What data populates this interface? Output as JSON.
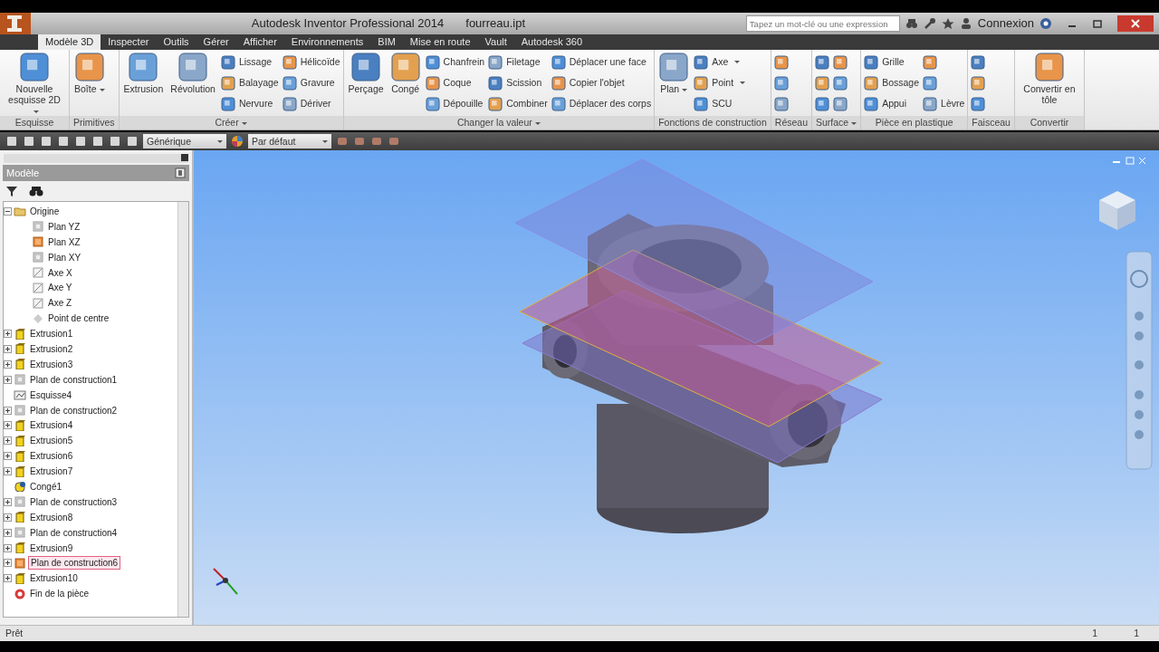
{
  "window": {
    "title": "Autodesk Inventor Professional 2014",
    "file": "fourreau.ipt"
  },
  "search": {
    "placeholder": "Tapez un mot-clé ou une expression"
  },
  "account": {
    "label": "Connexion"
  },
  "ribbon_tabs": [
    {
      "label": "Modèle 3D",
      "selected": true
    },
    {
      "label": "Inspecter",
      "selected": false
    },
    {
      "label": "Outils",
      "selected": false
    },
    {
      "label": "Gérer",
      "selected": false
    },
    {
      "label": "Afficher",
      "selected": false
    },
    {
      "label": "Environnements",
      "selected": false
    },
    {
      "label": "BIM",
      "selected": false
    },
    {
      "label": "Mise en route",
      "selected": false
    },
    {
      "label": "Vault",
      "selected": false
    },
    {
      "label": "Autodesk 360",
      "selected": false
    }
  ],
  "ribbon_groups": [
    {
      "label": "Esquisse",
      "dropdown": false,
      "items": [
        {
          "kind": "large",
          "label": "Nouvelle esquisse 2D",
          "dropdown": true
        }
      ]
    },
    {
      "label": "Primitives",
      "dropdown": false,
      "items": [
        {
          "kind": "large",
          "label": "Boîte",
          "dropdown": true
        }
      ]
    },
    {
      "label": "Créer",
      "dropdown": true,
      "items": [
        {
          "kind": "large",
          "label": "Extrusion",
          "dropdown": false
        },
        {
          "kind": "large",
          "label": "Révolution",
          "dropdown": false
        },
        {
          "kind": "stack",
          "tools": [
            {
              "kind": "tool",
              "label": "Lissage",
              "dropdown": false
            },
            {
              "kind": "tool",
              "label": "Balayage",
              "dropdown": false
            },
            {
              "kind": "tool",
              "label": "Nervure",
              "dropdown": false
            }
          ]
        },
        {
          "kind": "stack",
          "tools": [
            {
              "kind": "tool",
              "label": "Hélicoïde",
              "dropdown": false
            },
            {
              "kind": "tool",
              "label": "Gravure",
              "dropdown": false
            },
            {
              "kind": "tool",
              "label": "Dériver",
              "dropdown": false
            }
          ]
        }
      ]
    },
    {
      "label": "Changer la valeur",
      "dropdown": true,
      "items": [
        {
          "kind": "large",
          "label": "Perçage",
          "dropdown": false
        },
        {
          "kind": "large",
          "label": "Congé",
          "dropdown": false
        },
        {
          "kind": "stack",
          "tools": [
            {
              "kind": "tool",
              "label": "Chanfrein",
              "dropdown": false
            },
            {
              "kind": "tool",
              "label": "Coque",
              "dropdown": false
            },
            {
              "kind": "tool",
              "label": "Dépouille",
              "dropdown": false
            }
          ]
        },
        {
          "kind": "stack",
          "tools": [
            {
              "kind": "tool",
              "label": "Filetage",
              "dropdown": false
            },
            {
              "kind": "tool",
              "label": "Scission",
              "dropdown": false
            },
            {
              "kind": "tool",
              "label": "Combiner",
              "dropdown": false
            }
          ]
        },
        {
          "kind": "stack",
          "tools": [
            {
              "kind": "tool",
              "label": "Déplacer une face",
              "dropdown": false
            },
            {
              "kind": "tool",
              "label": "Copier l'objet",
              "dropdown": false
            },
            {
              "kind": "tool",
              "label": "Déplacer des corps",
              "dropdown": false
            }
          ]
        }
      ]
    },
    {
      "label": "Fonctions de construction",
      "dropdown": false,
      "items": [
        {
          "kind": "large",
          "label": "Plan",
          "dropdown": true
        },
        {
          "kind": "stack",
          "tools": [
            {
              "kind": "tool",
              "label": "Axe",
              "dropdown": true
            },
            {
              "kind": "tool",
              "label": "Point",
              "dropdown": true
            },
            {
              "kind": "tool",
              "label": "SCU",
              "dropdown": false
            }
          ]
        }
      ]
    },
    {
      "label": "Réseau",
      "dropdown": false,
      "items": [
        {
          "kind": "stack",
          "tools": [
            {
              "kind": "icon"
            },
            {
              "kind": "icon"
            },
            {
              "kind": "icon"
            }
          ]
        }
      ]
    },
    {
      "label": "Surface",
      "dropdown": true,
      "items": [
        {
          "kind": "stack",
          "tools": [
            {
              "kind": "icon"
            },
            {
              "kind": "icon"
            },
            {
              "kind": "icon"
            }
          ]
        },
        {
          "kind": "stack",
          "tools": [
            {
              "kind": "icon"
            },
            {
              "kind": "icon"
            },
            {
              "kind": "icon"
            }
          ]
        }
      ]
    },
    {
      "label": "Pièce en plastique",
      "dropdown": false,
      "items": [
        {
          "kind": "stack",
          "tools": [
            {
              "kind": "tool",
              "label": "Grille",
              "dropdown": false
            },
            {
              "kind": "tool",
              "label": "Bossage",
              "dropdown": false
            },
            {
              "kind": "tool",
              "label": "Appui",
              "dropdown": false
            }
          ]
        },
        {
          "kind": "stack",
          "tools": [
            {
              "kind": "icon"
            },
            {
              "kind": "icon"
            },
            {
              "kind": "tool",
              "label": "Lèvre",
              "dropdown": false
            }
          ]
        }
      ]
    },
    {
      "label": "Faisceau",
      "dropdown": false,
      "items": [
        {
          "kind": "stack",
          "tools": [
            {
              "kind": "icon"
            },
            {
              "kind": "icon"
            },
            {
              "kind": "icon"
            }
          ]
        }
      ]
    },
    {
      "label": "Convertir",
      "dropdown": false,
      "items": [
        {
          "kind": "large",
          "label": "Convertir en tôle",
          "dropdown": false
        }
      ]
    }
  ],
  "quick_toolbar": {
    "material": "Générique",
    "appearance": "Par défaut"
  },
  "browser": {
    "title": "Modèle",
    "tree": [
      {
        "label": "Origine",
        "kind": "folder",
        "expanded": true,
        "selected": false,
        "children": [
          {
            "label": "Plan YZ",
            "kind": "plane",
            "selected": false
          },
          {
            "label": "Plan XZ",
            "kind": "plane-visible",
            "selected": false
          },
          {
            "label": "Plan XY",
            "kind": "plane",
            "selected": false
          },
          {
            "label": "Axe X",
            "kind": "axis",
            "selected": false
          },
          {
            "label": "Axe Y",
            "kind": "axis",
            "selected": false
          },
          {
            "label": "Axe Z",
            "kind": "axis",
            "selected": false
          },
          {
            "label": "Point de centre",
            "kind": "point",
            "selected": false
          }
        ]
      },
      {
        "label": "Extrusion1",
        "kind": "extrusion",
        "expanded": false,
        "selected": false
      },
      {
        "label": "Extrusion2",
        "kind": "extrusion",
        "expanded": false,
        "selected": false
      },
      {
        "label": "Extrusion3",
        "kind": "extrusion",
        "expanded": false,
        "selected": false
      },
      {
        "label": "Plan de construction1",
        "kind": "plane",
        "expanded": false,
        "selected": false
      },
      {
        "label": "Esquisse4",
        "kind": "sketch",
        "selected": false
      },
      {
        "label": "Plan de construction2",
        "kind": "plane",
        "expanded": false,
        "selected": false
      },
      {
        "label": "Extrusion4",
        "kind": "extrusion",
        "expanded": false,
        "selected": false
      },
      {
        "label": "Extrusion5",
        "kind": "extrusion",
        "expanded": false,
        "selected": false
      },
      {
        "label": "Extrusion6",
        "kind": "extrusion",
        "expanded": false,
        "selected": false
      },
      {
        "label": "Extrusion7",
        "kind": "extrusion",
        "expanded": false,
        "selected": false
      },
      {
        "label": "Congé1",
        "kind": "fillet",
        "selected": false
      },
      {
        "label": "Plan de construction3",
        "kind": "plane",
        "expanded": false,
        "selected": false
      },
      {
        "label": "Extrusion8",
        "kind": "extrusion",
        "expanded": false,
        "selected": false
      },
      {
        "label": "Plan de construction4",
        "kind": "plane",
        "expanded": false,
        "selected": false
      },
      {
        "label": "Extrusion9",
        "kind": "extrusion",
        "expanded": false,
        "selected": false
      },
      {
        "label": "Plan de construction6",
        "kind": "plane-visible",
        "expanded": false,
        "selected": true
      },
      {
        "label": "Extrusion10",
        "kind": "extrusion",
        "expanded": false,
        "selected": false
      },
      {
        "label": "Fin de la pièce",
        "kind": "end",
        "selected": false
      }
    ]
  },
  "status_bar": {
    "text": "Prêt",
    "values": [
      "1",
      "1"
    ]
  }
}
